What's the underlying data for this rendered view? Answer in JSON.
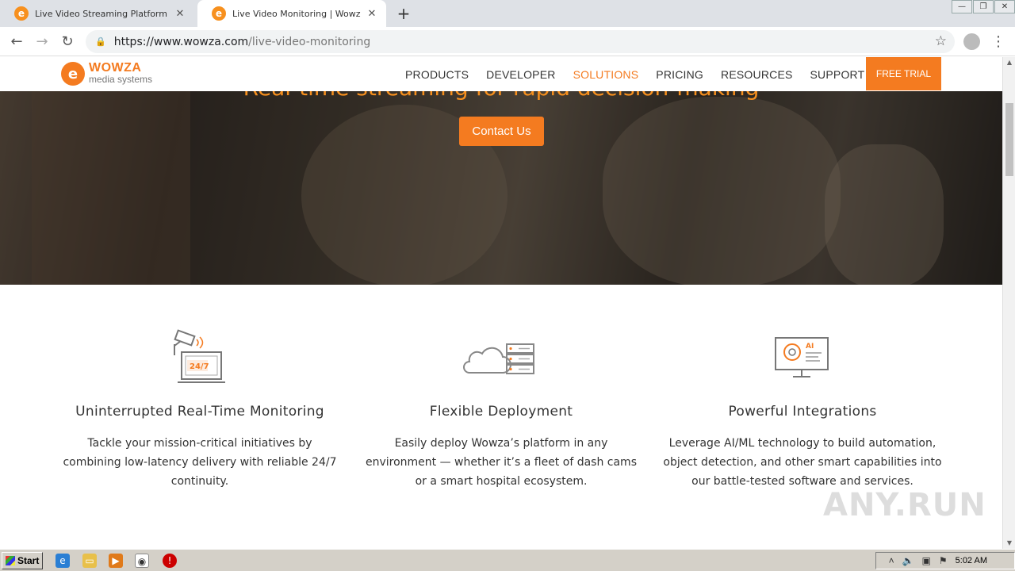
{
  "browser": {
    "tabs": [
      {
        "title": "Live Video Streaming Platform | Wow",
        "favicon": "wowza-icon"
      },
      {
        "title": "Live Video Monitoring | Wowza Medi",
        "favicon": "wowza-icon"
      }
    ],
    "url_host": "https://www.wowza.com",
    "url_path": "/live-video-monitoring"
  },
  "site_nav": {
    "logo_word": "WOWZA",
    "logo_sub": "media systems",
    "items": [
      "PRODUCTS",
      "DEVELOPER",
      "SOLUTIONS",
      "PRICING",
      "RESOURCES",
      "SUPPORT"
    ],
    "active_item": "SOLUTIONS",
    "cta": "FREE TRIAL"
  },
  "hero": {
    "headline": "Real-time streaming for rapid decision-making",
    "button": "Contact Us"
  },
  "features": [
    {
      "title": "Uninterrupted Real-Time Monitoring",
      "text": "Tackle your mission-critical initiatives by combining low-latency delivery with reliable 24/7 continuity.",
      "icon": "camera-monitor-icon",
      "icon_label": "24/7"
    },
    {
      "title": "Flexible Deployment",
      "text": "Easily deploy Wowza’s platform in any environment — whether it’s a fleet of dash cams or a smart hospital ecosystem.",
      "icon": "cloud-server-icon"
    },
    {
      "title": "Powerful Integrations",
      "text": "Leverage AI/ML technology to build automation, object detection, and other smart capabilities into our battle-tested software and services.",
      "icon": "ai-monitor-icon",
      "icon_label": "AI"
    }
  ],
  "watermark": "ANY.RUN",
  "taskbar": {
    "start": "Start",
    "clock": "5:02 AM"
  },
  "colors": {
    "brand_orange": "#f47b20",
    "headline_orange": "#f7901e"
  }
}
